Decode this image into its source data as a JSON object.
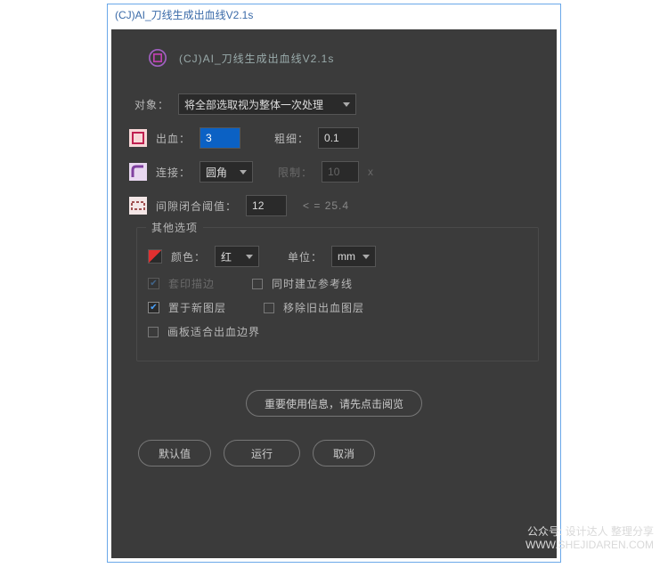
{
  "title": "(CJ)AI_刀线生成出血线V2.1s",
  "header_title": "(CJ)AI_刀线生成出血线V2.1s",
  "object_label": "对象：",
  "object_value": "将全部选取视为整体一次处理",
  "bleed_label": "出血：",
  "bleed_value": "3",
  "stroke_label": "粗细：",
  "stroke_value": "0.1",
  "join_label": "连接：",
  "join_value": "圆角",
  "limit_label": "限制：",
  "limit_value": "10",
  "limit_suffix": "x",
  "gap_label": "间隙闭合阈值：",
  "gap_value": "12",
  "gap_hint": "< = 25.4",
  "other_title": "其他选项",
  "color_label": "颜色：",
  "color_value": "红",
  "unit_label": "单位：",
  "unit_value": "mm",
  "opt_print": "套印描边",
  "opt_guide": "同时建立参考线",
  "opt_newlayer": "置于新图层",
  "opt_removeold": "移除旧出血图层",
  "opt_artboard": "画板适合出血边界",
  "info_btn": "重要使用信息，请先点击阅览",
  "btn_default": "默认值",
  "btn_run": "运行",
  "btn_cancel": "取消",
  "watermark1": "公众号: 设计达人 整理分享",
  "watermark2": "WWW.SHEJIDAREN.COM"
}
